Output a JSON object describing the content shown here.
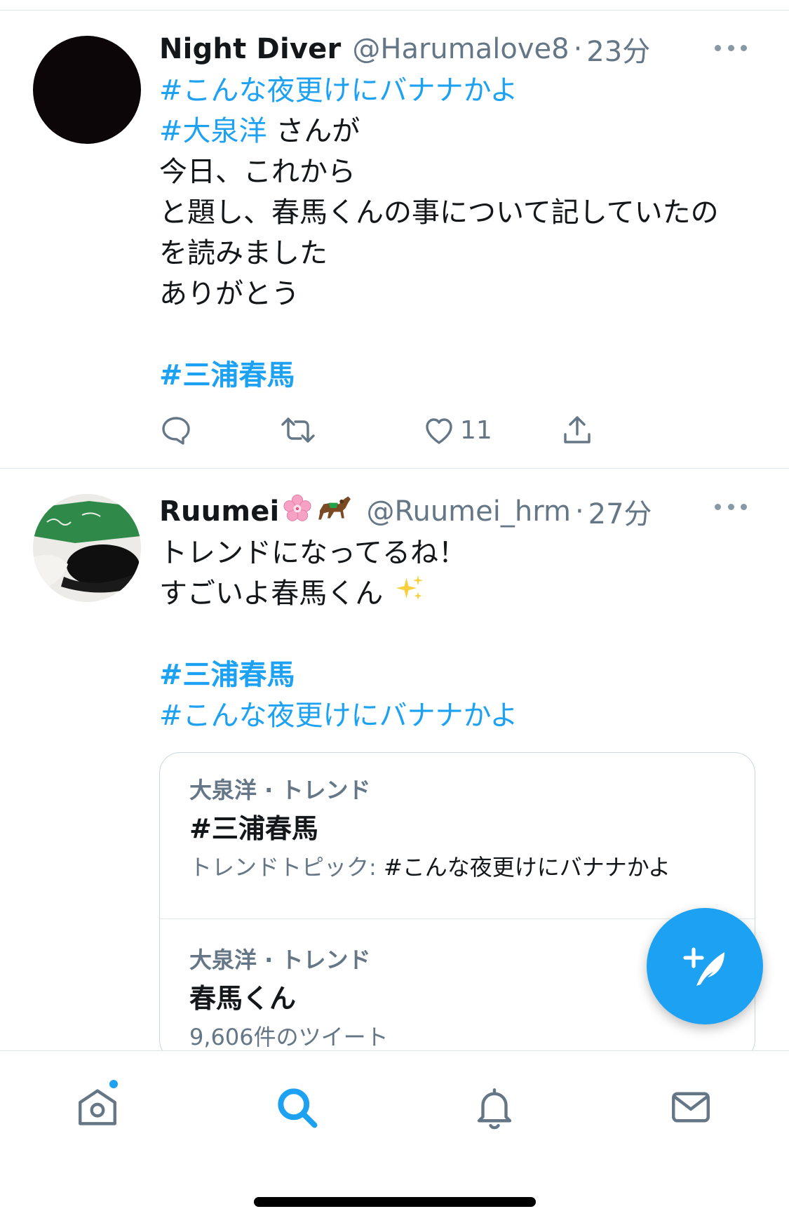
{
  "colors": {
    "accent": "#1da1f2",
    "text_primary": "#14171a",
    "text_secondary": "#657786",
    "divider": "#e1e8ed"
  },
  "tweets": [
    {
      "display_name": "Night Diver",
      "handle": "@Harumalove8",
      "separator": "·",
      "time": "23分",
      "hashtag_1": "#こんな夜更けにバナナかよ",
      "hashtag_2": "#大泉洋",
      "text_after_hashtag_2": " さんが",
      "lines": [
        "今日、これから",
        "と題し、春馬くんの事について記していたの",
        "を読みました",
        "ありがとう"
      ],
      "hashtag_3": "#三浦春馬",
      "like_count": "11"
    },
    {
      "display_name": "Ruumei",
      "name_emojis": [
        "cherry-blossom",
        "horse"
      ],
      "handle": "@Ruumei_hrm",
      "separator": "·",
      "time": "27分",
      "lines": [
        "トレンドになってるね！",
        "すごいよ春馬くん"
      ],
      "sparkles_emoji": "sparkles",
      "hashtag_1": "#三浦春馬",
      "hashtag_2": "#こんな夜更けにバナナかよ"
    }
  ],
  "trend_card": {
    "items": [
      {
        "meta": "大泉洋 · トレンド",
        "title": "#三浦春馬",
        "sub_label": "トレンドトピック: ",
        "sub_topic": "#こんな夜更けにバナナかよ"
      },
      {
        "meta": "大泉洋 · トレンド",
        "title": "春馬くん",
        "sub_label": "9,606件のツイート"
      }
    ]
  },
  "tabbar": {
    "tabs": [
      "home",
      "search",
      "notifications",
      "messages"
    ],
    "active": "search",
    "home_has_badge": true
  }
}
